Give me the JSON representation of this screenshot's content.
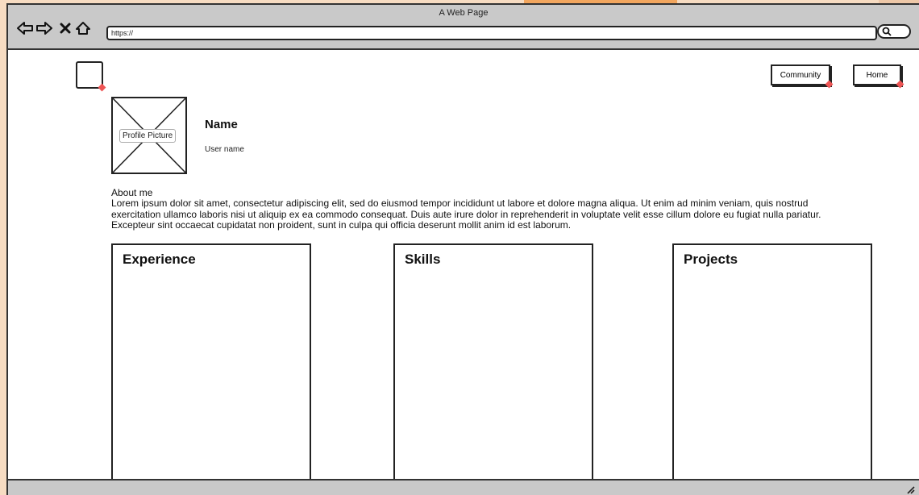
{
  "window": {
    "title": "A Web Page",
    "url": "https://"
  },
  "nav_icons": [
    "back-arrow-icon",
    "forward-arrow-icon",
    "stop-icon",
    "home-icon"
  ],
  "header": {
    "community_label": "Community",
    "home_label": "Home"
  },
  "profile": {
    "picture_label": "Profile Picture",
    "name": "Name",
    "username": "User name"
  },
  "about": {
    "title": "About me",
    "text": "Lorem ipsum dolor sit amet, consectetur adipiscing elit, sed do eiusmod tempor incididunt ut labore et dolore magna aliqua. Ut enim ad minim veniam, quis nostrud exercitation ullamco laboris nisi ut aliquip ex ea commodo consequat. Duis aute irure dolor in reprehenderit in voluptate velit esse cillum dolore eu fugiat nulla pariatur. Excepteur sint occaecat cupidatat non proident, sunt in culpa qui officia deserunt mollit anim id est laborum."
  },
  "panels": [
    {
      "title": "Experience"
    },
    {
      "title": "Skills"
    },
    {
      "title": "Projects"
    }
  ],
  "colors": {
    "background": "#f7dcc2",
    "accent_orange": "#f2a65e",
    "chrome": "#c9c9c9",
    "ink": "#222222",
    "marker": "#ee5555"
  }
}
